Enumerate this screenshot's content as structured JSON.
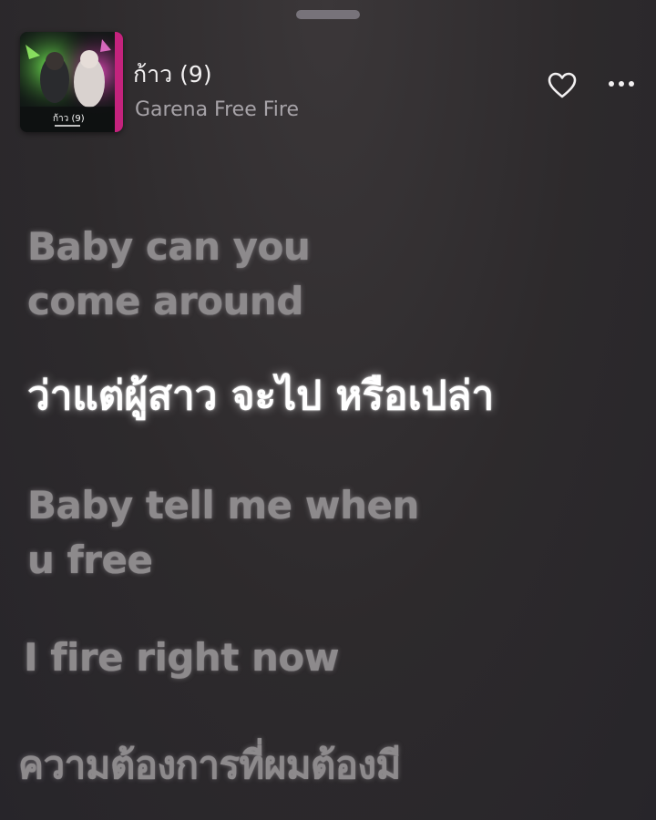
{
  "now_playing": {
    "title": "ก้าว (9)",
    "artist": "Garena Free Fire",
    "cover_title_text": "ก้าว (9)"
  },
  "actions": {
    "favorite_icon": "heart-icon",
    "more_icon": "ellipsis-icon"
  },
  "lyrics": [
    {
      "lines": [
        "Baby can you",
        "come around"
      ],
      "state": "past"
    },
    {
      "lines": [
        "ว่าแต่ผู้สาว จะไป หรือเปล่า"
      ],
      "state": "current"
    },
    {
      "lines": [
        "Baby tell me when",
        "u free"
      ],
      "state": "upcoming"
    },
    {
      "lines": [
        "I fire right now"
      ],
      "state": "upcoming"
    },
    {
      "lines": [
        "ความต้องการที่ผมต้องมี"
      ],
      "state": "upcoming"
    }
  ],
  "colors": {
    "background": "#2d2a2c",
    "active_lyric": "#ffffff",
    "inactive_lyric": "#8d8a8c",
    "artist_text": "#a7a3a8"
  }
}
